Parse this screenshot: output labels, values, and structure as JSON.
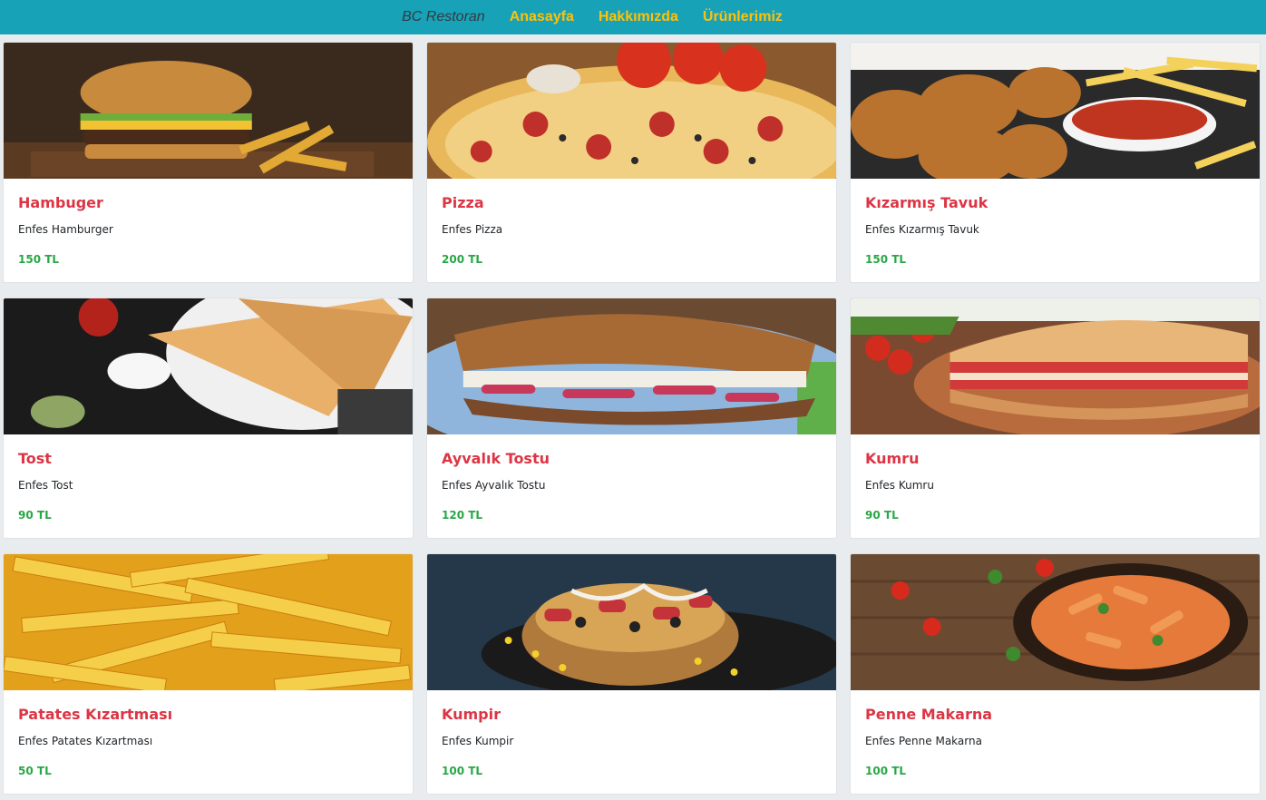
{
  "navbar": {
    "brand": "BC Restoran",
    "links": [
      "Anasayfa",
      "Hakkımızda",
      "Ürünlerimiz"
    ]
  },
  "products": [
    {
      "name": "Hambuger",
      "desc": "Enfes Hamburger",
      "price": "150 TL",
      "image_icon": "hamburger-photo",
      "bg": "#3a2a1e"
    },
    {
      "name": "Pizza",
      "desc": "Enfes Pizza",
      "price": "200 TL",
      "image_icon": "pizza-photo",
      "bg": "#c2692a"
    },
    {
      "name": "Kızarmış Tavuk",
      "desc": "Enfes Kızarmış Tavuk",
      "price": "150 TL",
      "image_icon": "fried-chicken-photo",
      "bg": "#2c2c2c"
    },
    {
      "name": "Tost",
      "desc": "Enfes Tost",
      "price": "90 TL",
      "image_icon": "toast-photo",
      "bg": "#1b1b1b"
    },
    {
      "name": "Ayvalık Tostu",
      "desc": "Enfes Ayvalık Tostu",
      "price": "120 TL",
      "image_icon": "ayvalik-toast-photo",
      "bg": "#7b9fc9"
    },
    {
      "name": "Kumru",
      "desc": "Enfes Kumru",
      "price": "90 TL",
      "image_icon": "kumru-photo",
      "bg": "#7a4a30"
    },
    {
      "name": "Patates Kızartması",
      "desc": "Enfes Patates Kızartması",
      "price": "50 TL",
      "image_icon": "french-fries-photo",
      "bg": "#e8a81a"
    },
    {
      "name": "Kumpir",
      "desc": "Enfes Kumpir",
      "price": "100 TL",
      "image_icon": "kumpir-photo",
      "bg": "#24384a"
    },
    {
      "name": "Penne Makarna",
      "desc": "Enfes Penne Makarna",
      "price": "100 TL",
      "image_icon": "penne-pasta-photo",
      "bg": "#6b4a32"
    }
  ]
}
